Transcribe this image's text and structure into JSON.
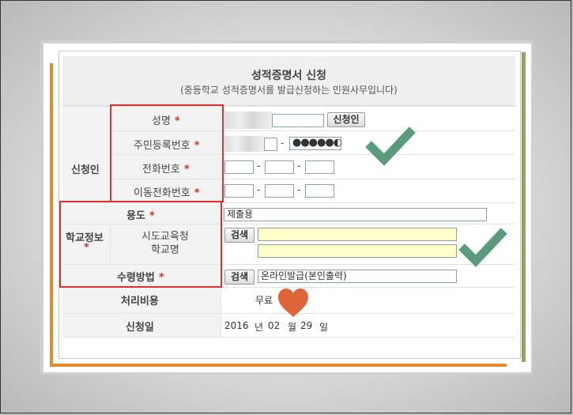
{
  "header": {
    "title": "성적증명서 신청",
    "subtitle": "(중등학교 성적증명서를 발급신청하는 민원사무입니다)"
  },
  "applicant": {
    "section_label": "신청인",
    "name_label": "성명",
    "rrn_label": "주민등록번호",
    "phone_label": "전화번호",
    "mobile_label": "이동전화번호",
    "required_mark": "*",
    "applicant_button": "신청인",
    "rrn_masked": "●●●●●◐",
    "dash": "-"
  },
  "purpose": {
    "label": "용도",
    "value": "제출용"
  },
  "school": {
    "section_label": "학교정보",
    "sub_label_1": "시도교육청",
    "sub_label_2": "학교명",
    "search_button": "검색"
  },
  "receipt": {
    "label": "수령방법",
    "search_button": "검색",
    "value": "온라인발급(본인출력)"
  },
  "fee": {
    "label": "처리비용",
    "value": "무료"
  },
  "date": {
    "label": "신청일",
    "year": "2016",
    "year_unit": "년",
    "month": "02",
    "month_unit": "월",
    "day": "29",
    "day_unit": "일"
  },
  "colors": {
    "highlight_box": "#e03030",
    "checkmark": "#5a9a7e",
    "heart": "#e0643a",
    "frame_orange": "#e58a2c",
    "frame_green": "#8ea46a"
  }
}
